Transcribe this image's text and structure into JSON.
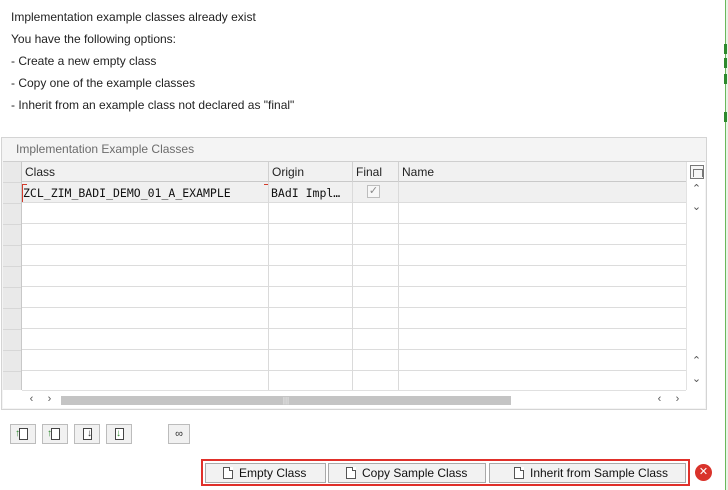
{
  "messages": [
    "Implementation example classes already exist",
    "You have the following options:",
    "- Create a new empty class",
    "- Copy one of the example classes",
    "- Inherit from an example class not declared as \"final\""
  ],
  "table": {
    "title": "Implementation Example Classes",
    "columns": {
      "class": "Class",
      "origin": "Origin",
      "final": "Final",
      "name": "Name"
    },
    "rows": [
      {
        "class": "ZCL_ZIM_BADI_DEMO_01_A_EXAMPLE",
        "origin": "BAdI Impl…",
        "final": true,
        "name": ""
      }
    ]
  },
  "toolbar": {
    "icons": [
      "move-up-icon",
      "insert-row-icon",
      "move-down-icon",
      "download-icon",
      "glasses-icon"
    ]
  },
  "actions": {
    "empty_class": "Empty Class",
    "copy_sample": "Copy Sample Class",
    "inherit_sample": "Inherit from Sample Class"
  },
  "colors": {
    "highlight_border": "#e0302a",
    "close_button": "#d9332b"
  }
}
